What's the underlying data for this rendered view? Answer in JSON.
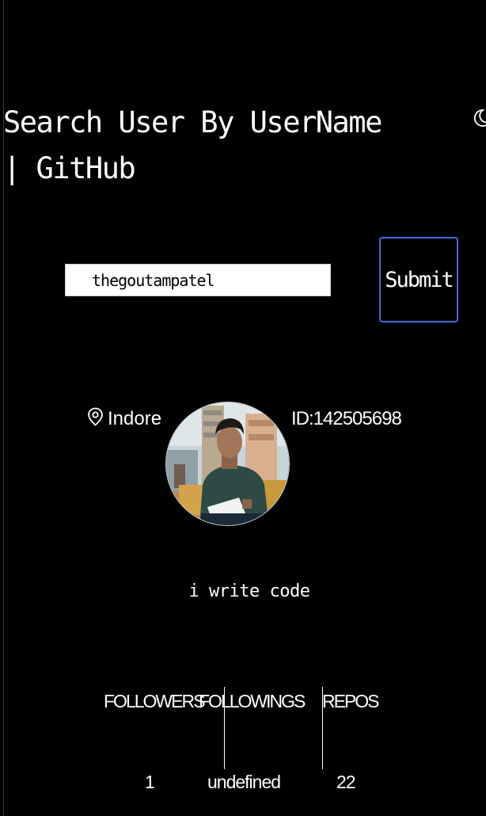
{
  "header": {
    "title": "Search User By UserName\n| GitHub",
    "theme_toggle_icon": "moon-icon"
  },
  "search": {
    "value": "thegoutampatel",
    "submit_label": "Submit"
  },
  "profile": {
    "location": "Indore",
    "location_icon": "location-pin-icon",
    "id_text": "ID:142505698",
    "bio": "i write code"
  },
  "stats": {
    "followers_label": "FOLLOWERS",
    "followings_label": "FOLLOWINGS",
    "repos_label": "REPOS",
    "followers_value": "1",
    "followings_value": "undefined",
    "repos_value": "22"
  },
  "colors": {
    "background": "#000000",
    "text": "#ffffff",
    "button_border": "#3b6fd8"
  }
}
